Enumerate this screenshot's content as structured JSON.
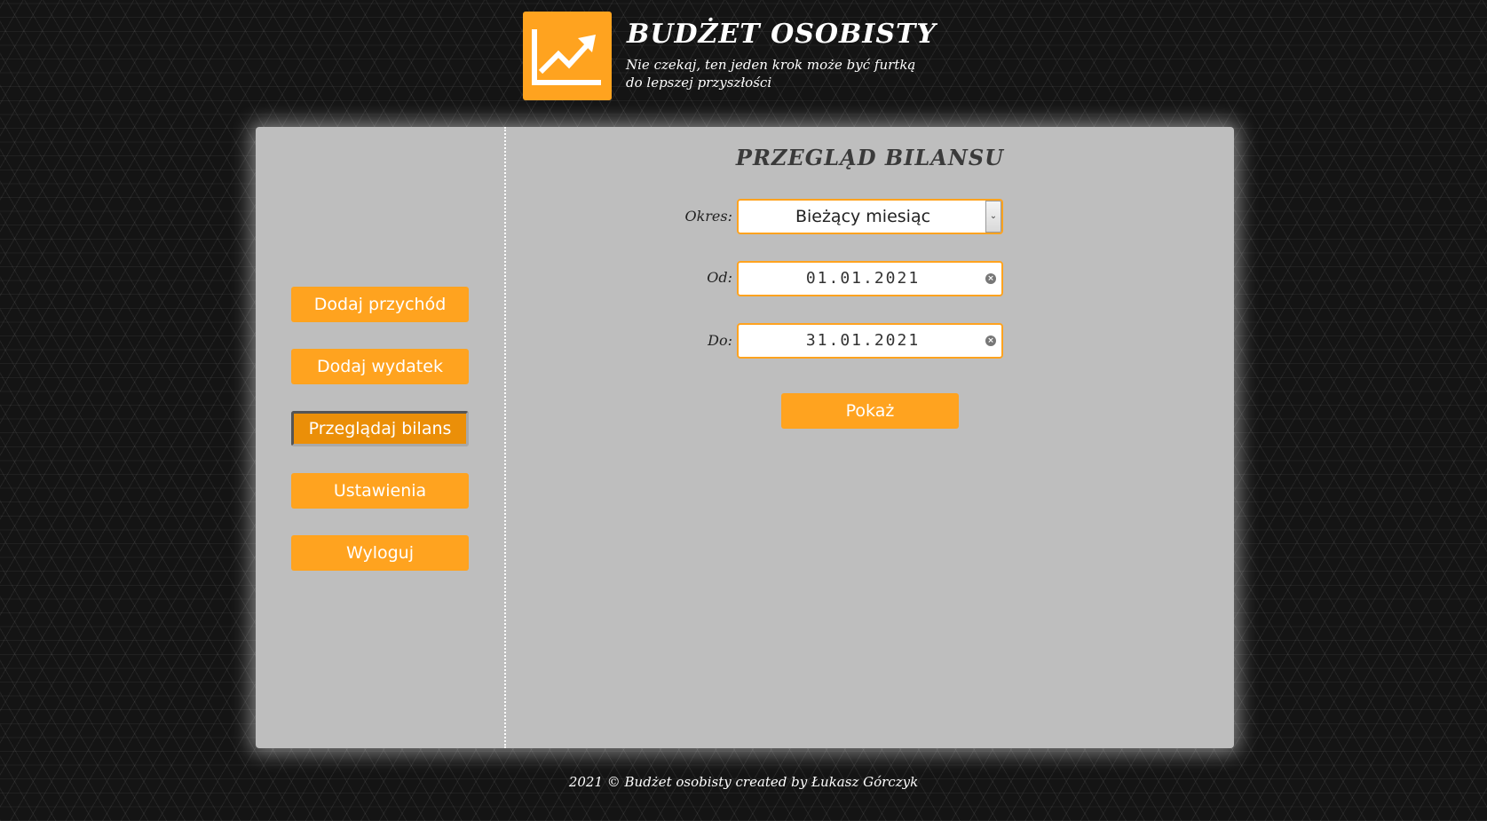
{
  "header": {
    "logo_icon": "chart-trending-up-icon",
    "title": "BUDŻET OSOBISTY",
    "subtitle": "Nie czekaj, ten jeden krok może być furtką do lepszej przyszłości"
  },
  "sidebar": {
    "items": [
      {
        "label": "Dodaj przychód",
        "active": false
      },
      {
        "label": "Dodaj wydatek",
        "active": false
      },
      {
        "label": "Przeglądaj bilans",
        "active": true
      },
      {
        "label": "Ustawienia",
        "active": false
      },
      {
        "label": "Wyloguj",
        "active": false
      }
    ]
  },
  "main": {
    "title": "PRZEGLĄD BILANSU",
    "period": {
      "label": "Okres:",
      "selected": "Bieżący miesiąc"
    },
    "from": {
      "label": "Od:",
      "value": "01.01.2021"
    },
    "to": {
      "label": "Do:",
      "value": "31.01.2021"
    },
    "show_button": "Pokaż"
  },
  "footer": {
    "text": "2021 © Budżet osobisty created by Łukasz Górczyk"
  },
  "colors": {
    "accent": "#ffa31f",
    "accent_active": "#eb8f08",
    "panel": "#bebebe",
    "background": "#141414"
  }
}
